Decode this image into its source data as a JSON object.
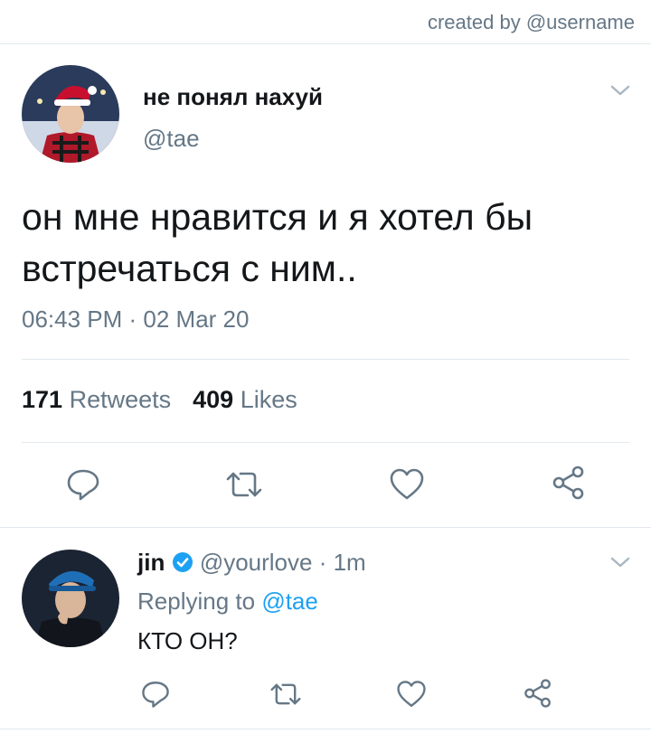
{
  "credit": "created by @username",
  "main_tweet": {
    "display_name": "не понял нахуй",
    "handle": "@tae",
    "text": "он мне нравится и я хотел бы встречаться с ним..",
    "timestamp": "06:43 PM · 02 Mar 20",
    "retweets_count": "171",
    "retweets_label": "Retweets",
    "likes_count": "409",
    "likes_label": "Likes"
  },
  "reply_tweet": {
    "display_name": "jin",
    "handle": "@yourlove",
    "time": "· 1m",
    "replying_label": "Replying to",
    "replying_to": "@tae",
    "text": "КТО ОН?"
  },
  "colors": {
    "accent": "#1da1f2",
    "muted": "#657786",
    "divider": "#e1e8ed"
  },
  "icons": [
    "chevron-down-icon",
    "reply-icon",
    "retweet-icon",
    "like-icon",
    "share-icon",
    "verified-badge-icon"
  ]
}
